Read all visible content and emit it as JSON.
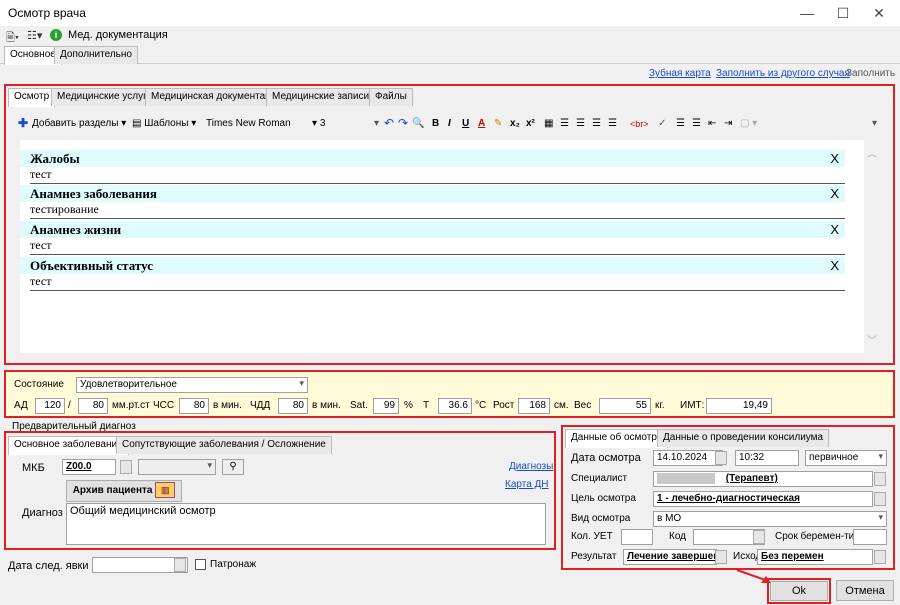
{
  "window": {
    "title": "Осмотр врача",
    "minimize": "—",
    "maximize": "☐",
    "close": "✕"
  },
  "toolbar": {
    "med_docs": "Мед. документация"
  },
  "top_tabs": [
    "Основное",
    "Дополнительно"
  ],
  "links": {
    "dental": "Зубная карта",
    "fill_from": "Заполнить из другого случая",
    "fill": "Заполнить"
  },
  "inner_tabs": [
    "Осмотр",
    "Медицинские услуги",
    "Медицинская документация",
    "Медицинские записи",
    "Файлы"
  ],
  "editor_toolbar": {
    "add_sections": "Добавить разделы",
    "templates": "Шаблоны",
    "font": "Times New Roman",
    "size": "3",
    "x_btn": "X"
  },
  "sections": [
    {
      "title": "Жалобы",
      "text": "тест"
    },
    {
      "title": "Анамнез заболевания",
      "text": "тестирование"
    },
    {
      "title": "Анамнез жизни",
      "text": "тест"
    },
    {
      "title": "Объективный статус",
      "text": "тест"
    }
  ],
  "vitals": {
    "state_label": "Состояние",
    "state_value": "Удовлетворительное",
    "ad_label": "АД",
    "ad_sys": "120",
    "slash": "/",
    "ad_dia": "80",
    "ad_unit": "мм.рт.ст",
    "hss_label": "ЧСС",
    "hss": "80",
    "hss_unit": "в мин.",
    "chdd_label": "ЧДД",
    "chdd": "80",
    "chdd_unit": "в мин.",
    "sat_label": "Sat.",
    "sat": "99",
    "sat_unit": "%",
    "t_label": "T",
    "t": "36.6",
    "t_unit": "°C",
    "height_label": "Рост",
    "height": "168",
    "height_unit": "см.",
    "weight_label": "Вес",
    "weight": "55",
    "weight_unit": "кг.",
    "imt_label": "ИМТ:",
    "imt": "19,49"
  },
  "diagnosis": {
    "group_label": "Предварительный диагноз",
    "tabs": [
      "Основное заболевание",
      "Сопутствующие заболевания / Осложнение"
    ],
    "mkb_label": "МКБ",
    "mkb_value": "Z00.0",
    "link_diagnoses": "Диагнозы",
    "link_card": "Карта ДН",
    "archive_button": "Архив пациента",
    "diag_label": "Диагноз",
    "diag_text": "Общий медицинский осмотр"
  },
  "next_visit": {
    "label": "Дата след. явки",
    "patronage": "Патронаж"
  },
  "exam": {
    "tabs": [
      "Данные об осмотре",
      "Данные о проведении консилиума"
    ],
    "date_label": "Дата осмотра",
    "date": "14.10.2024",
    "time": "10:32",
    "visit_type": "первичное",
    "spec_label": "Специалист",
    "spec_value": "(Терапевт)",
    "goal_label": "Цель осмотра",
    "goal_value": "1 - лечебно-диагностическая",
    "kind_label": "Вид осмотра",
    "kind_value": "в МО",
    "uet_label": "Кол. УЕТ",
    "code_label": "Код",
    "preg_label": "Срок беремен-ти",
    "result_label": "Результат",
    "result_value": "Лечение завершен",
    "outcome_label": "Исход",
    "outcome_value": "Без перемен"
  },
  "buttons": {
    "ok": "Ok",
    "cancel": "Отмена"
  },
  "colors": {
    "highlight_red": "#e02020",
    "section_bg": "#e0fbfd",
    "vitals_bg": "#fffbd9",
    "link": "#1a4cc8"
  }
}
